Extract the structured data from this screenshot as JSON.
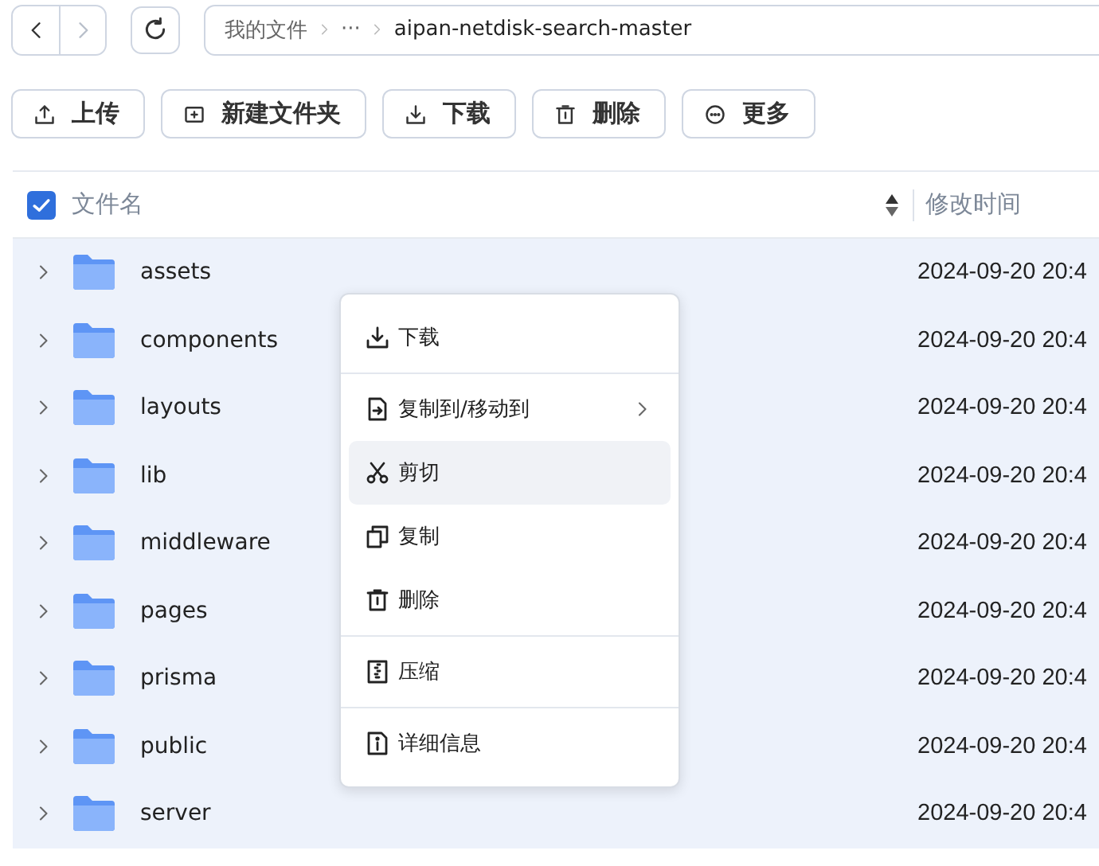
{
  "nav": {
    "back_disabled": false,
    "forward_disabled": true,
    "breadcrumb": [
      "我的文件",
      "···",
      "aipan-netdisk-search-master"
    ]
  },
  "toolbar": [
    "上传",
    "新建文件夹",
    "下载",
    "删除",
    "更多"
  ],
  "table": {
    "select_all_checked": true,
    "columns": [
      "文件名",
      "修改时间"
    ],
    "rows": [
      {
        "name": "assets",
        "modified": "2024-09-20 20:4",
        "selected": true,
        "expanded": false
      },
      {
        "name": "components",
        "modified": "2024-09-20 20:4",
        "selected": true,
        "expanded": false
      },
      {
        "name": "layouts",
        "modified": "2024-09-20 20:4",
        "selected": true,
        "expanded": false
      },
      {
        "name": "lib",
        "modified": "2024-09-20 20:4",
        "selected": true,
        "expanded": false
      },
      {
        "name": "middleware",
        "modified": "2024-09-20 20:4",
        "selected": true,
        "expanded": false
      },
      {
        "name": "pages",
        "modified": "2024-09-20 20:4",
        "selected": true,
        "expanded": false
      },
      {
        "name": "prisma",
        "modified": "2024-09-20 20:4",
        "selected": true,
        "expanded": false
      },
      {
        "name": "public",
        "modified": "2024-09-20 20:4",
        "selected": true,
        "expanded": false
      },
      {
        "name": "server",
        "modified": "2024-09-20 20:4",
        "selected": true,
        "expanded": false
      }
    ]
  },
  "context_menu": {
    "groups": [
      [
        {
          "label": "下载",
          "highlighted": false,
          "has_submenu": false
        }
      ],
      [
        {
          "label": "复制到/移动到",
          "highlighted": false,
          "has_submenu": true
        },
        {
          "label": "剪切",
          "highlighted": true,
          "has_submenu": false
        },
        {
          "label": "复制",
          "highlighted": false,
          "has_submenu": false
        },
        {
          "label": "删除",
          "highlighted": false,
          "has_submenu": false
        }
      ],
      [
        {
          "label": "压缩",
          "highlighted": false,
          "has_submenu": false
        }
      ],
      [
        {
          "label": "详细信息",
          "highlighted": false,
          "has_submenu": false
        }
      ]
    ]
  }
}
